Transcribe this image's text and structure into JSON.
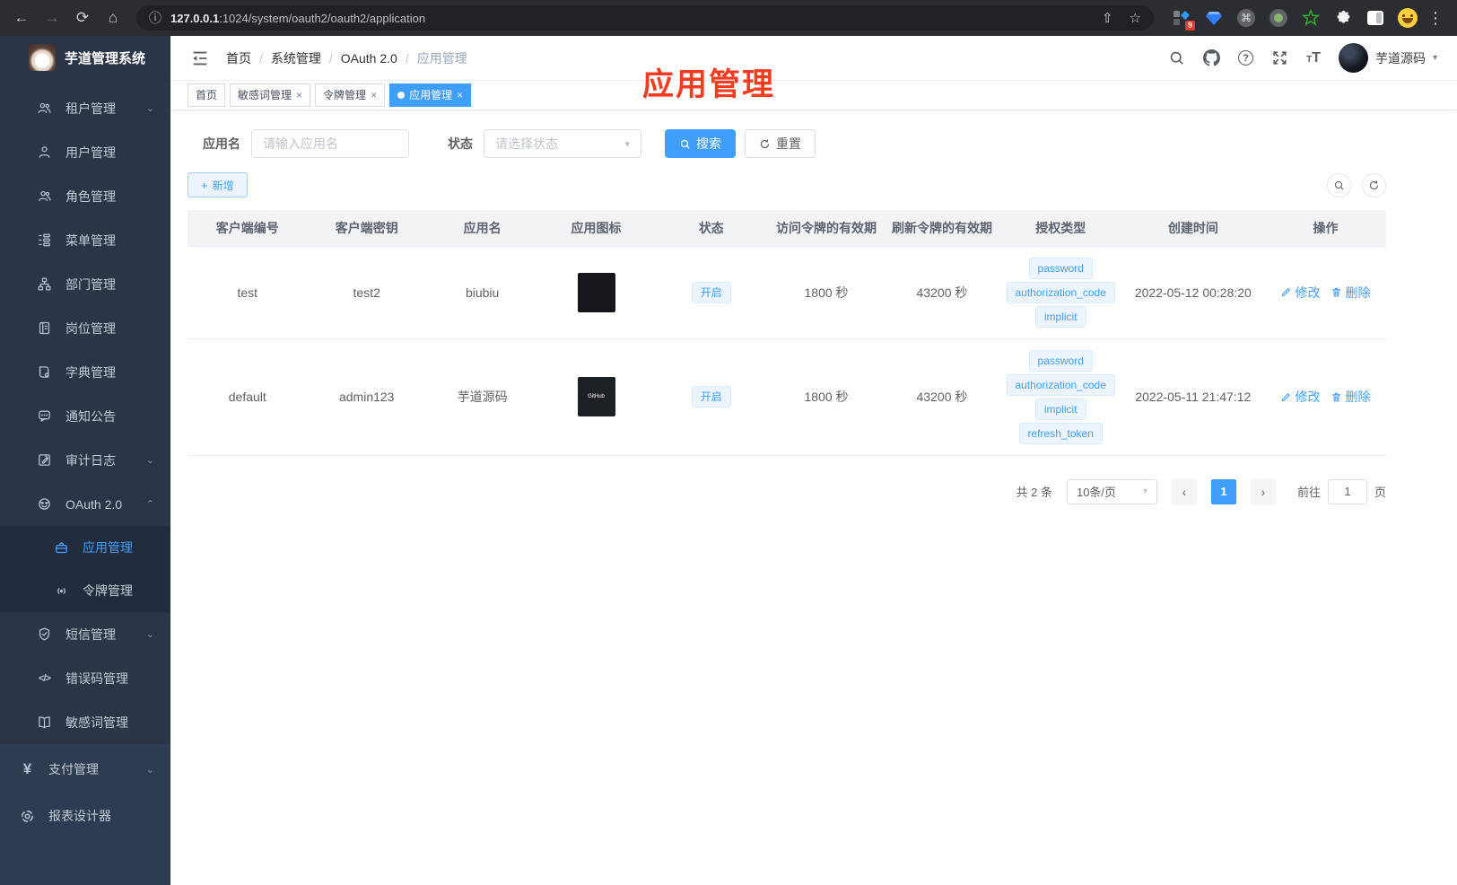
{
  "browser": {
    "url_host": "127.0.0.1",
    "url_rest": ":1024/system/oauth2/oauth2/application",
    "extension_badge": "9",
    "extensions": [
      "tabs-grid-extension-icon",
      "gem-extension-icon",
      "command-extension-icon",
      "record-extension-icon",
      "star-extension-icon",
      "puzzle-extension-icon",
      "panel-extension-icon",
      "emoji-extension-icon"
    ]
  },
  "sidebar": {
    "title": "芋道管理系统",
    "items": [
      {
        "key": "tenant",
        "label": "租户管理",
        "icon": "users-icon",
        "arrow": "down"
      },
      {
        "key": "user",
        "label": "用户管理",
        "icon": "user-icon"
      },
      {
        "key": "role",
        "label": "角色管理",
        "icon": "roles-icon"
      },
      {
        "key": "menu",
        "label": "菜单管理",
        "icon": "menu-tree-icon"
      },
      {
        "key": "dept",
        "label": "部门管理",
        "icon": "org-icon"
      },
      {
        "key": "post",
        "label": "岗位管理",
        "icon": "badge-icon"
      },
      {
        "key": "dict",
        "label": "字典管理",
        "icon": "dict-icon"
      },
      {
        "key": "notice",
        "label": "通知公告",
        "icon": "message-icon"
      },
      {
        "key": "audit-log",
        "label": "审计日志",
        "icon": "log-icon",
        "arrow": "down"
      },
      {
        "key": "oauth2",
        "label": "OAuth 2.0",
        "icon": "robot-icon",
        "arrow": "up",
        "children": [
          {
            "key": "oauth2-application",
            "label": "应用管理",
            "icon": "briefcase-icon",
            "active": true
          },
          {
            "key": "oauth2-token",
            "label": "令牌管理",
            "icon": "broadcast-icon"
          }
        ]
      },
      {
        "key": "sms",
        "label": "短信管理",
        "icon": "shield-icon",
        "arrow": "down"
      },
      {
        "key": "error-code",
        "label": "错误码管理",
        "icon": "code-icon"
      },
      {
        "key": "sensitive-word",
        "label": "敏感词管理",
        "icon": "book-open-icon"
      }
    ],
    "bottom_items": [
      {
        "key": "pay",
        "label": "支付管理",
        "icon": "yen-icon",
        "arrow": "down"
      },
      {
        "key": "report-designer",
        "label": "报表设计器",
        "icon": "report-icon"
      }
    ]
  },
  "header": {
    "breadcrumb": [
      "首页",
      "系统管理",
      "OAuth 2.0",
      "应用管理"
    ],
    "username": "芋道源码",
    "annotation": "应用管理"
  },
  "tabs": [
    {
      "key": "home",
      "label": "首页",
      "closable": false,
      "active": false
    },
    {
      "key": "sensitive-word",
      "label": "敏感词管理",
      "closable": true,
      "active": false
    },
    {
      "key": "token",
      "label": "令牌管理",
      "closable": true,
      "active": false
    },
    {
      "key": "application",
      "label": "应用管理",
      "closable": true,
      "active": true
    }
  ],
  "filters": {
    "app_name_label": "应用名",
    "app_name_placeholder": "请输入应用名",
    "status_label": "状态",
    "status_placeholder": "请选择状态",
    "search_label": "搜索",
    "reset_label": "重置",
    "add_label": "新增"
  },
  "table": {
    "columns": [
      "客户端编号",
      "客户端密钥",
      "应用名",
      "应用图标",
      "状态",
      "访问令牌的有效期",
      "刷新令牌的有效期",
      "授权类型",
      "创建时间",
      "操作"
    ],
    "edit_label": "修改",
    "delete_label": "删除",
    "rows": [
      {
        "client_id": "test",
        "secret": "test2",
        "app_name": "biubiu",
        "icon": "screenshot",
        "status": "开启",
        "access_ttl": "1800 秒",
        "refresh_ttl": "43200 秒",
        "grant_types": [
          "password",
          "authorization_code",
          "implicit"
        ],
        "created": "2022-05-12 00:28:20"
      },
      {
        "client_id": "default",
        "secret": "admin123",
        "app_name": "芋道源码",
        "icon": "github",
        "icon_label": "GitHub",
        "status": "开启",
        "access_ttl": "1800 秒",
        "refresh_ttl": "43200 秒",
        "grant_types": [
          "password",
          "authorization_code",
          "implicit",
          "refresh_token"
        ],
        "created": "2022-05-11 21:47:12"
      }
    ]
  },
  "pagination": {
    "total_text": "共 2 条",
    "page_size": "10条/页",
    "active_page": "1",
    "goto_label": "前往",
    "goto_value": "1",
    "unit_label": "页"
  },
  "colors": {
    "accent": "#409eff",
    "annotation_red": "#f73b20",
    "sidebar_bg": "#2a3548",
    "submenu_bg": "#212d3e",
    "tag_bg": "#ecf5ff"
  }
}
